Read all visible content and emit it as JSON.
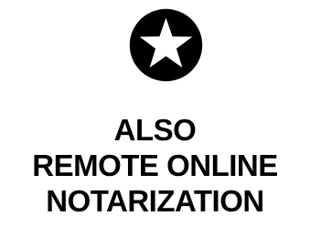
{
  "badge": {
    "icon": "star-in-circle-icon",
    "circle_color": "#000000",
    "star_color": "#ffffff"
  },
  "caption": {
    "lines": [
      "ALSO",
      "REMOTE ONLINE",
      "NOTARIZATION"
    ],
    "color": "#000000"
  }
}
